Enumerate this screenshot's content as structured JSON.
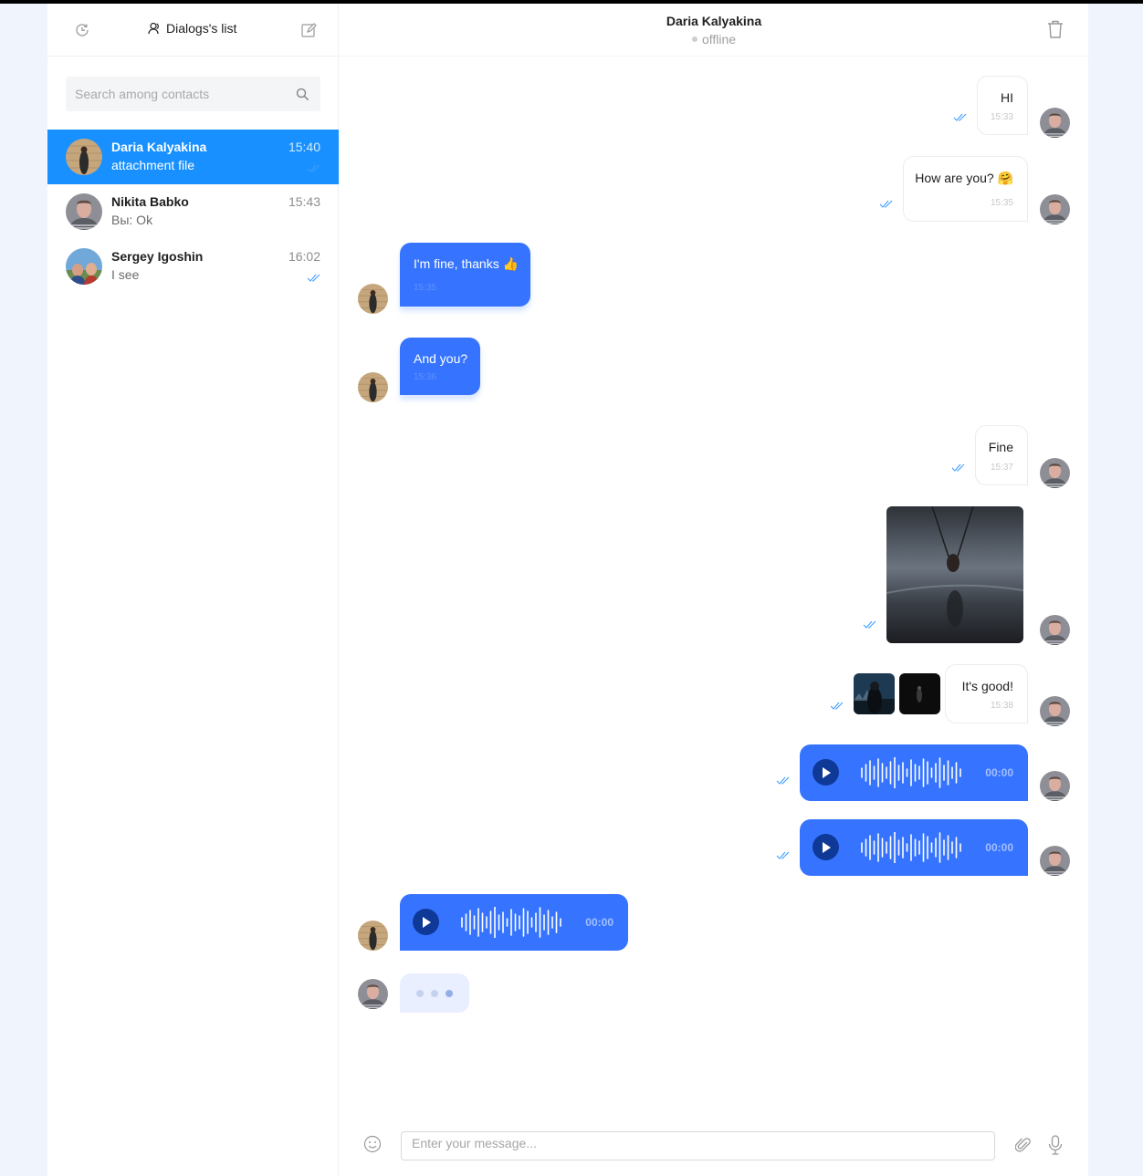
{
  "sidebar": {
    "title": "Dialogs's list",
    "search_placeholder": "Search among contacts",
    "dialogs": [
      {
        "name": "Daria Kalyakina",
        "last": "attachment file",
        "time": "15:40",
        "active": true
      },
      {
        "name": "Nikita Babko",
        "last": "Вы: Ok",
        "time": "15:43",
        "active": false
      },
      {
        "name": "Sergey Igoshin",
        "last": "I see",
        "time": "16:02",
        "active": false,
        "read": true
      }
    ]
  },
  "chat": {
    "contact_name": "Daria Kalyakina",
    "status": "offline",
    "messages": [
      {
        "from": "me",
        "text": "HI",
        "time": "15:33"
      },
      {
        "from": "me",
        "text": "How are you? 🤗",
        "time": "15:35"
      },
      {
        "from": "them",
        "text": "I'm fine, thanks 👍",
        "time": "15:35"
      },
      {
        "from": "them",
        "text": "And you?",
        "time": "15:36"
      },
      {
        "from": "me",
        "text": "Fine",
        "time": "15:37"
      },
      {
        "from": "me",
        "type": "image"
      },
      {
        "from": "me",
        "text": "It's good!",
        "time": "15:38",
        "attachments": 2
      },
      {
        "from": "me",
        "type": "audio",
        "duration": "00:00"
      },
      {
        "from": "me",
        "type": "audio",
        "duration": "00:00"
      },
      {
        "from": "them",
        "type": "audio",
        "duration": "00:00"
      },
      {
        "from": "them",
        "type": "typing"
      }
    ]
  },
  "composer": {
    "placeholder": "Enter your message..."
  },
  "colors": {
    "accent": "#1890ff",
    "bubble_in": "#3674ff",
    "play_button": "#0f3997"
  }
}
